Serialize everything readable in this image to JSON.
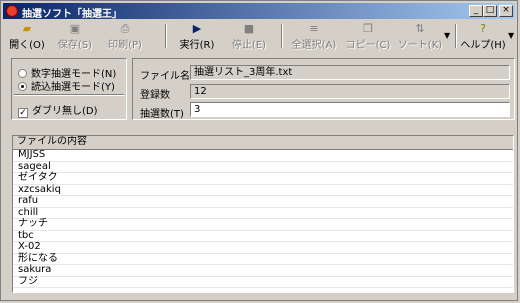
{
  "window": {
    "title": "抽選ソフト「抽選王」"
  },
  "toolbar": [
    {
      "label": "開く(O)",
      "icon": "open-folder-icon",
      "enabled": true
    },
    {
      "label": "保存(S)",
      "icon": "save-disk-icon",
      "enabled": false
    },
    {
      "label": "印刷(P)",
      "icon": "print-icon",
      "enabled": false
    },
    {
      "label": "実行(R)",
      "icon": "play-icon",
      "enabled": true
    },
    {
      "label": "停止(E)",
      "icon": "stop-icon",
      "enabled": false
    },
    {
      "label": "全選択(A)",
      "icon": "select-all-icon",
      "enabled": false
    },
    {
      "label": "コピー(C)",
      "icon": "copy-icon",
      "enabled": false
    },
    {
      "label": "ソート(K)",
      "icon": "sort-az-icon",
      "enabled": false
    },
    {
      "label": "ヘルプ(H)",
      "icon": "help-icon",
      "enabled": true
    }
  ],
  "mode": {
    "numeric": "数字抽選モード(N)",
    "load": "読込抽選モード(Y)",
    "selected": "load",
    "no_duplicate": "ダブリ無し(D)",
    "no_duplicate_checked": true
  },
  "info": {
    "filename_label": "ファイル名",
    "filename": "抽選リスト_3周年.txt",
    "count_label": "登録数",
    "count": "12",
    "draw_label": "抽選数(T)",
    "draw": "3"
  },
  "list": {
    "header": "ファイルの内容",
    "items": [
      "MJJSS",
      "sageal",
      "ゼイタク",
      "xzcsakiq",
      "rafu",
      "chill",
      "ナッチ",
      "tbc",
      "X-02",
      "形になる",
      "sakura",
      "フジ"
    ]
  }
}
